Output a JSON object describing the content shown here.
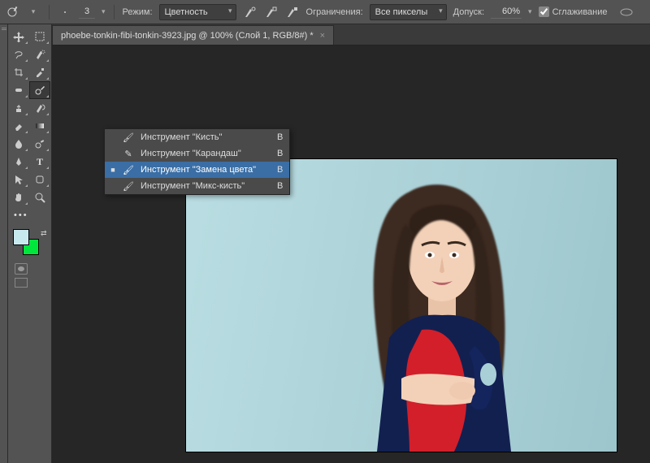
{
  "options_bar": {
    "brush_size": "3",
    "mode_label": "Режим:",
    "mode_value": "Цветность",
    "limits_label": "Ограничения:",
    "limits_value": "Все пикселы",
    "tolerance_label": "Допуск:",
    "tolerance_value": "60%",
    "antialias_label": "Сглаживание",
    "antialias_checked": true
  },
  "tab": {
    "title": "phoebe-tonkin-fibi-tonkin-3923.jpg @ 100% (Слой 1, RGB/8#) *"
  },
  "tool_flyout": {
    "items": [
      {
        "icon": "brush-icon",
        "label": "Инструмент \"Кисть\"",
        "key": "B",
        "selected": false
      },
      {
        "icon": "pencil-icon",
        "label": "Инструмент \"Карандаш\"",
        "key": "B",
        "selected": false
      },
      {
        "icon": "color-replace-icon",
        "label": "Инструмент \"Замена цвета\"",
        "key": "B",
        "selected": true
      },
      {
        "icon": "mixer-brush-icon",
        "label": "Инструмент \"Микс-кисть\"",
        "key": "B",
        "selected": false
      }
    ]
  },
  "swatches": {
    "foreground": "#c6e9ee",
    "background": "#00e63d"
  },
  "icons": {
    "brush": "🖌",
    "pencil": "✎",
    "color_replace": "🖌",
    "mixer": "🖌"
  }
}
